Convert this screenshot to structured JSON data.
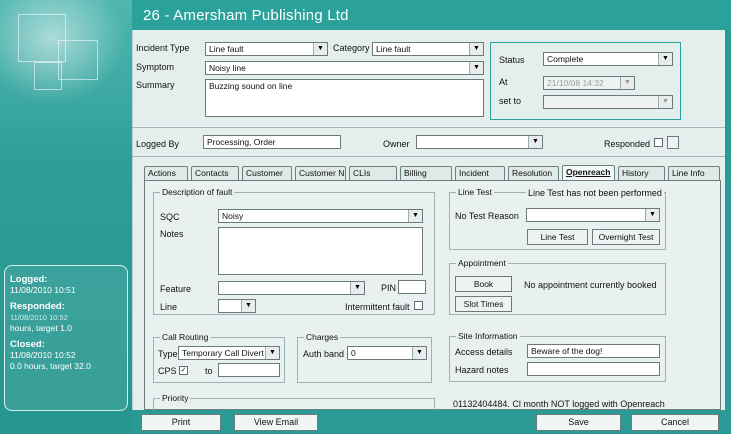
{
  "title": "26 - Amersham Publishing Ltd",
  "incident": {
    "incident_type_label": "Incident Type",
    "incident_type_value": "Line fault",
    "category_label": "Category",
    "category_value": "Line fault",
    "symptom_label": "Symptom",
    "symptom_value": "Noisy line",
    "summary_label": "Summary",
    "summary_value": "Buzzing sound on line",
    "status_label": "Status",
    "status_value": "Complete",
    "at_label": "At",
    "at_value": "21/10/08 14:32",
    "set_to_label": "set to",
    "logged_by_label": "Logged By",
    "logged_by_value": "Processing, Order",
    "owner_label": "Owner",
    "responded_label": "Responded"
  },
  "tabs": [
    "Actions",
    "Contacts",
    "Customer",
    "Customer N",
    "CLIs",
    "Billing",
    "Incident",
    "Resolution",
    "Openreach",
    "History",
    "Line Info"
  ],
  "active_tab": "Openreach",
  "openreach": {
    "description_group": "Description of fault",
    "sqc_label": "SQC",
    "sqc_value": "Noisy",
    "notes_label": "Notes",
    "feature_label": "Feature",
    "pin_label": "PIN",
    "line_label": "Line",
    "intermittent_label": "Intermittent fault",
    "call_routing_group": "Call Routing",
    "type_label": "Type",
    "type_value": "Temporary Call Divert",
    "cps_label": "CPS",
    "to_label": "to",
    "charges_group": "Charges",
    "auth_band_label": "Auth band",
    "auth_band_value": "0",
    "priority_group": "Priority",
    "line_test_group": "Line Test",
    "line_test_status": "Line Test has not been performed",
    "no_test_reason_label": "No Test Reason",
    "line_test_button": "Line Test",
    "overnight_test_button": "Overnight Test",
    "appointment_group": "Appointment",
    "book_button": "Book",
    "appointment_status": "No appointment currently booked",
    "slot_times_button": "Slot Times",
    "site_info_group": "Site Information",
    "access_details_label": "Access details",
    "access_details_value": "Beware of the dog!",
    "hazard_notes_label": "Hazard notes",
    "footer_note": "01132404484. Cl month NOT logged with Openreach"
  },
  "sidebar": {
    "logged_label": "Logged:",
    "logged_value": "11/08/2010 10:51",
    "responded_label": "Responded:",
    "responded_value": "11/08/2010 10:52",
    "responded_detail": "hours, target 1.0",
    "closed_label": "Closed:",
    "closed_value": "11/08/2010 10:52",
    "closed_detail": "0.0 hours, target 32.0"
  },
  "buttons": {
    "print": "Print",
    "view_email": "View Email",
    "save": "Save",
    "cancel": "Cancel"
  },
  "colors": {
    "background": "#2a9a94",
    "panel": "#e4eeed",
    "status_border": "#27a59e"
  }
}
